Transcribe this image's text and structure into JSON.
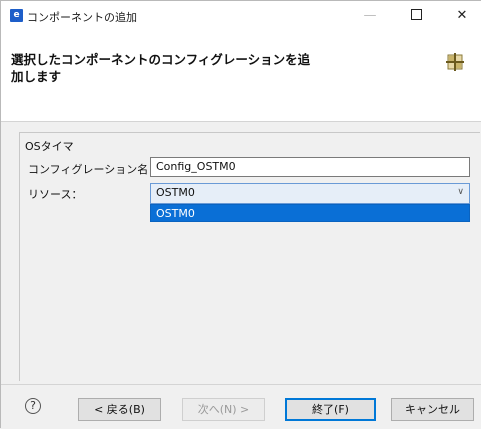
{
  "window": {
    "icon_text": "e",
    "title": "コンポーネントの追加",
    "min_symbol": "—",
    "close_symbol": "✕"
  },
  "header": {
    "title": "選択したコンポーネントのコンフィグレーションを追加します"
  },
  "form": {
    "group_label": "OSタイマ",
    "config_name_label": "コンフィグレーション名：",
    "config_name_value": "Config_OSTM0",
    "resource_label": "リソース：",
    "resource_selected": "OSTM0",
    "resource_options": [
      "OSTM0"
    ]
  },
  "footer": {
    "help_symbol": "?",
    "back_label": "< 戻る(B)",
    "next_label": "次へ(N) >",
    "finish_label": "終了(F)",
    "cancel_label": "キャンセル"
  },
  "colors": {
    "accent": "#0078d7",
    "dropdown_highlight": "#0a6fd6",
    "select_bg": "#e6eef8"
  }
}
